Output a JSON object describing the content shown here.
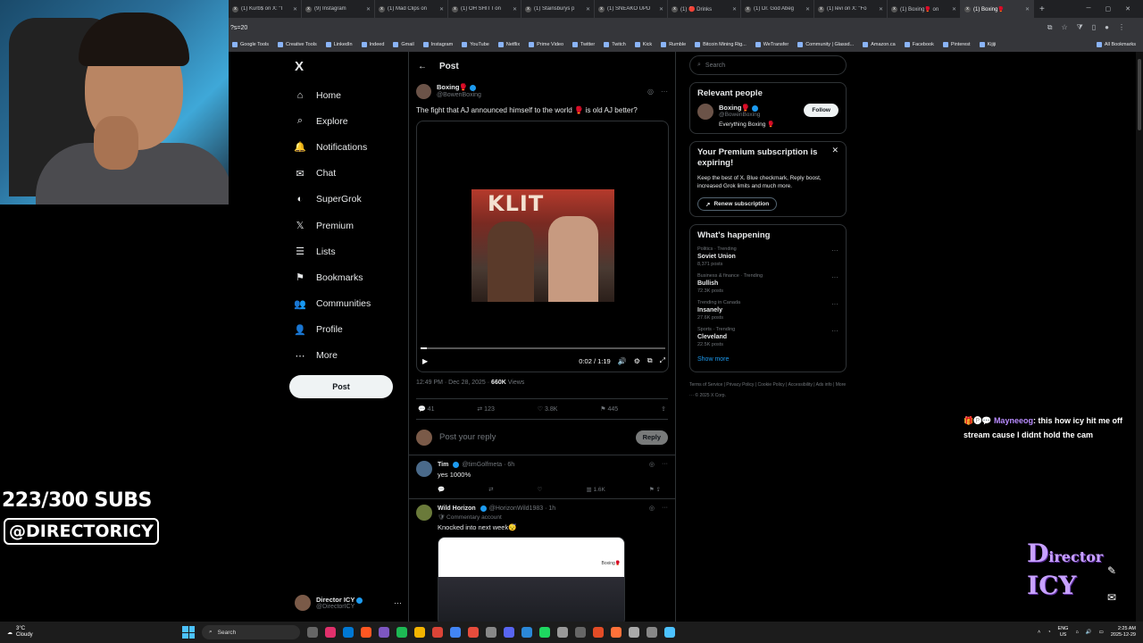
{
  "browser": {
    "tabs": [
      {
        "label": "(1) Kurb$ on X: \"I",
        "icon": "x-icon",
        "active": false
      },
      {
        "label": "(9) Instagram",
        "icon": "instagram-icon",
        "active": false
      },
      {
        "label": "(1) Mad Clips on",
        "icon": "x-icon",
        "active": false
      },
      {
        "label": "(1) OH SHIT I on",
        "icon": "x-icon",
        "active": false
      },
      {
        "label": "(1) Stainsburys p",
        "icon": "x-icon",
        "active": false
      },
      {
        "label": "(1) SNEAKO UPD",
        "icon": "x-icon",
        "active": false
      },
      {
        "label": "(1) 🔴 Drinks",
        "icon": "x-icon",
        "active": false
      },
      {
        "label": "(1) Dr. God Abeg",
        "icon": "x-icon",
        "active": false
      },
      {
        "label": "(1) levi on X: \"Fo",
        "icon": "x-icon",
        "active": false
      },
      {
        "label": "(1) Boxing🥊 on",
        "icon": "x-icon",
        "active": false
      },
      {
        "label": "(1) Boxing🥊",
        "icon": "x-icon",
        "active": true
      }
    ],
    "url_fragment": "?s=20",
    "bookmarks": [
      "Google Tools",
      "Creative Tools",
      "LinkedIn",
      "Indeed",
      "Gmail",
      "Instagram",
      "YouTube",
      "Netflix",
      "Prime Video",
      "Twitter",
      "Twitch",
      "Kick",
      "Rumble",
      "Bitcoin Mining Rig...",
      "WeTransfer",
      "Community | Glassd...",
      "Amazon.ca",
      "Facebook",
      "Pinterest",
      "Kijiji"
    ],
    "all_bookmarks": "All Bookmarks"
  },
  "nav": {
    "logo": "X",
    "items": [
      {
        "label": "Home",
        "icon": "home-icon",
        "glyph": "⌂"
      },
      {
        "label": "Explore",
        "icon": "search-icon",
        "glyph": "⌕"
      },
      {
        "label": "Notifications",
        "icon": "bell-icon",
        "glyph": "🔔"
      },
      {
        "label": "Chat",
        "icon": "mail-icon",
        "glyph": "✉"
      },
      {
        "label": "SuperGrok",
        "icon": "grok-icon",
        "glyph": "◐"
      },
      {
        "label": "Premium",
        "icon": "x-premium-icon",
        "glyph": "𝕏"
      },
      {
        "label": "Lists",
        "icon": "list-icon",
        "glyph": "☰"
      },
      {
        "label": "Bookmarks",
        "icon": "bookmark-icon",
        "glyph": "⚑"
      },
      {
        "label": "Communities",
        "icon": "people-icon",
        "glyph": "👥"
      },
      {
        "label": "Profile",
        "icon": "person-icon",
        "glyph": "👤"
      },
      {
        "label": "More",
        "icon": "more-circle-icon",
        "glyph": "⋯"
      }
    ],
    "post_button": "Post",
    "account": {
      "name": "Director ICY",
      "handle": "@DirectorICY"
    }
  },
  "post": {
    "header": "Post",
    "author": {
      "name": "Boxing🥊",
      "handle": "@BowenBoxing"
    },
    "text": "The fight that AJ announced himself to the world 🥊 is old AJ better?",
    "video": {
      "thumbnail_text": "KLIT",
      "time": "0:02 / 1:19",
      "progress": 0.025
    },
    "timestamp": "12:49 PM · Dec 28, 2025 · ",
    "views_count": "660K",
    "views_label": " Views",
    "stats": {
      "replies": "41",
      "reposts": "123",
      "likes": "3.8K",
      "bookmarks": "445"
    },
    "reply_placeholder": "Post your reply",
    "reply_button": "Reply"
  },
  "comments": [
    {
      "name": "Tim",
      "handle": "@timGolfmeta · 6h",
      "text": "yes 1000%",
      "views": "1.6K"
    },
    {
      "name": "Wild Horizon",
      "handle": "@HorizonWild1983 · 1h",
      "sub": "🛡 Commentary account",
      "text": "Knocked into next week😴",
      "image_label": "Boxing🥊"
    }
  ],
  "right": {
    "search_placeholder": "Search",
    "relevant": {
      "title": "Relevant people",
      "name": "Boxing🥊",
      "handle": "@BowenBoxing",
      "bio": "Everything Boxing 🥊",
      "follow": "Follow"
    },
    "premium": {
      "title": "Your Premium subscription is expiring!",
      "text": "Keep the best of X. Blue checkmark, Reply boost, increased Grok limits and much more.",
      "button": "Renew subscription"
    },
    "happening": {
      "title": "What's happening",
      "trends": [
        {
          "category": "Politics · Trending",
          "topic": "Soviet Union",
          "count": "8,371 posts"
        },
        {
          "category": "Business & finance · Trending",
          "topic": "Bullish",
          "count": "72.3K posts"
        },
        {
          "category": "Trending in Canada",
          "topic": "Insanely",
          "count": "27.6K posts"
        },
        {
          "category": "Sports · Trending",
          "topic": "Cleveland",
          "count": "22.5K posts"
        }
      ],
      "show_more": "Show more"
    },
    "footer": "Terms of Service | Privacy Policy | Cookie Policy | Accessibility | Ads info | More ··· © 2025 X Corp."
  },
  "overlay": {
    "chat_user": "Mayneeog",
    "chat_text": ": this how icy hit me off stream cause I didnt hold the cam",
    "chat_badges": "🎁🅟💬",
    "subs": "223/300 SUBS",
    "handle": "@DIRECTORICY",
    "logo_text": "Director ICY"
  },
  "taskbar": {
    "weather_temp": "3°C",
    "weather_desc": "Cloudy",
    "search": "Search",
    "lang1": "ENG",
    "lang2": "US",
    "time": "2:25 AM",
    "date": "2025-12-29"
  }
}
